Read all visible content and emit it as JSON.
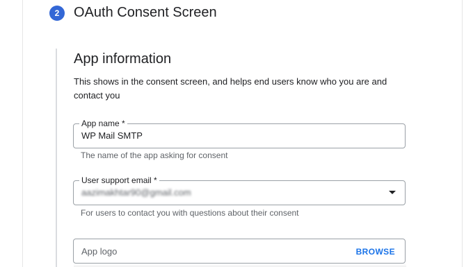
{
  "step": {
    "number": "2",
    "title": "OAuth Consent Screen"
  },
  "section": {
    "title": "App information",
    "description": "This shows in the consent screen, and helps end users know who you are and contact you"
  },
  "fields": {
    "app_name": {
      "label": "App name *",
      "value": "WP Mail SMTP",
      "helper": "The name of the app asking for consent"
    },
    "support_email": {
      "label": "User support email *",
      "value": "aazimakhtar90@gmail.com",
      "helper": "For users to contact you with questions about their consent",
      "icon": "dropdown-arrow-icon"
    },
    "app_logo": {
      "placeholder": "App logo",
      "action_label": "BROWSE"
    }
  },
  "colors": {
    "accent": "#3367d6",
    "link": "#1a73e8",
    "border": "#9aa0a6",
    "helper_text": "#5f6368"
  }
}
